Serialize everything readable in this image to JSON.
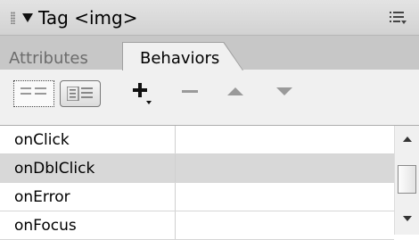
{
  "panel": {
    "title": "Tag <img>",
    "icons": {
      "collapse": "collapse-triangle-icon",
      "grip": "panel-grip-icon",
      "menu": "panel-options-menu-icon"
    }
  },
  "tabs": [
    {
      "label": "Attributes",
      "active": false
    },
    {
      "label": "Behaviors",
      "active": true
    }
  ],
  "toolbar": {
    "buttons": [
      {
        "icon": "show-set-events-icon",
        "selected": true
      },
      {
        "icon": "show-all-events-icon",
        "selected": false
      },
      {
        "icon": "add-behavior-plus-icon",
        "enabled": true
      },
      {
        "icon": "remove-behavior-minus-icon",
        "enabled": false
      },
      {
        "icon": "move-up-arrow-icon",
        "enabled": false
      },
      {
        "icon": "move-down-arrow-icon",
        "enabled": false
      }
    ]
  },
  "events": {
    "items": [
      {
        "name": "onClick",
        "action": ""
      },
      {
        "name": "onDblClick",
        "action": "",
        "selected": true
      },
      {
        "name": "onError",
        "action": ""
      },
      {
        "name": "onFocus",
        "action": ""
      }
    ]
  },
  "colors": {
    "selected_row": "#d8d8d8",
    "panel_bg": "#f0f0f0",
    "tab_strip": "#c7c7c7",
    "disabled_icon": "#9a9a9a"
  }
}
